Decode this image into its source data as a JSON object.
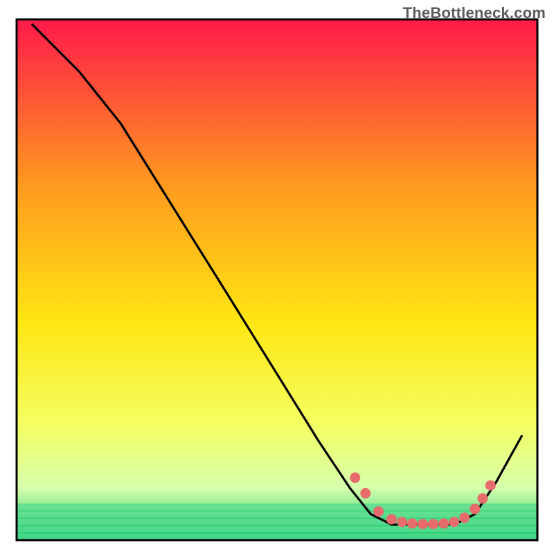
{
  "watermark": "TheBottleneck.com",
  "colors": {
    "gradient_top": "#ff1a4a",
    "gradient_upper_mid": "#ff9a1f",
    "gradient_mid": "#ffe612",
    "gradient_lower_mid": "#f4ff63",
    "gradient_low": "#d6ffad",
    "gradient_bottom": "#13c76a",
    "line": "#000000",
    "dot": "#e86b6b",
    "frame": "#000000"
  },
  "chart_data": {
    "type": "line",
    "title": "",
    "xlabel": "",
    "ylabel": "",
    "xlim": [
      0,
      100
    ],
    "ylim": [
      0,
      100
    ],
    "curve": [
      {
        "x": 3,
        "y": 99
      },
      {
        "x": 12,
        "y": 90
      },
      {
        "x": 20,
        "y": 80
      },
      {
        "x": 40,
        "y": 48
      },
      {
        "x": 58,
        "y": 19
      },
      {
        "x": 64,
        "y": 10
      },
      {
        "x": 68,
        "y": 5
      },
      {
        "x": 72,
        "y": 3
      },
      {
        "x": 78,
        "y": 3
      },
      {
        "x": 84,
        "y": 3
      },
      {
        "x": 88,
        "y": 5
      },
      {
        "x": 92,
        "y": 11
      },
      {
        "x": 97,
        "y": 20
      }
    ],
    "dots": [
      {
        "x": 65,
        "y": 12
      },
      {
        "x": 67,
        "y": 9
      },
      {
        "x": 69.5,
        "y": 5.5
      },
      {
        "x": 72,
        "y": 4
      },
      {
        "x": 74,
        "y": 3.5
      },
      {
        "x": 76,
        "y": 3.2
      },
      {
        "x": 78,
        "y": 3.1
      },
      {
        "x": 80,
        "y": 3.1
      },
      {
        "x": 82,
        "y": 3.2
      },
      {
        "x": 84,
        "y": 3.5
      },
      {
        "x": 86,
        "y": 4.3
      },
      {
        "x": 88,
        "y": 6
      },
      {
        "x": 89.5,
        "y": 8
      },
      {
        "x": 91,
        "y": 10.5
      }
    ],
    "green_band_top_y": 7
  }
}
